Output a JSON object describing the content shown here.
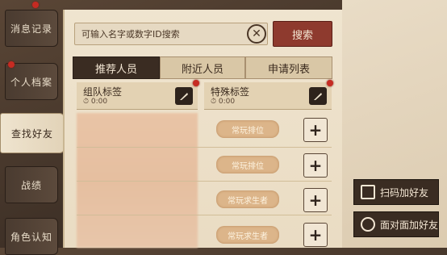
{
  "sidebar": {
    "items": [
      {
        "label": "消息记录"
      },
      {
        "label": "个人档案"
      },
      {
        "label": "查找好友"
      },
      {
        "label": "战绩"
      },
      {
        "label": "角色认知"
      }
    ]
  },
  "search": {
    "placeholder": "可输入名字或数字ID搜索",
    "button_label": "搜索",
    "clear_glyph": "✕"
  },
  "tabs": [
    {
      "label": "推荐人员"
    },
    {
      "label": "附近人员"
    },
    {
      "label": "申请列表"
    }
  ],
  "columns": {
    "team_tag": {
      "title": "组队标签",
      "time": "0:00"
    },
    "special_tag": {
      "title": "特殊标签",
      "time": "0:00"
    }
  },
  "rows": [
    {
      "tag": "常玩排位",
      "add_glyph": "+"
    },
    {
      "tag": "常玩排位",
      "add_glyph": "+"
    },
    {
      "tag": "常玩求生者",
      "add_glyph": "+"
    },
    {
      "tag": "常玩求生者",
      "add_glyph": "+"
    }
  ],
  "right_actions": {
    "scan_label": "扫码加好友",
    "face_label": "面对面加好友"
  },
  "colors": {
    "accent_red": "#8e3a2e",
    "notification_dot": "#c62b22",
    "parchment": "#efe4cf",
    "dark_wood": "#3a2c22"
  }
}
